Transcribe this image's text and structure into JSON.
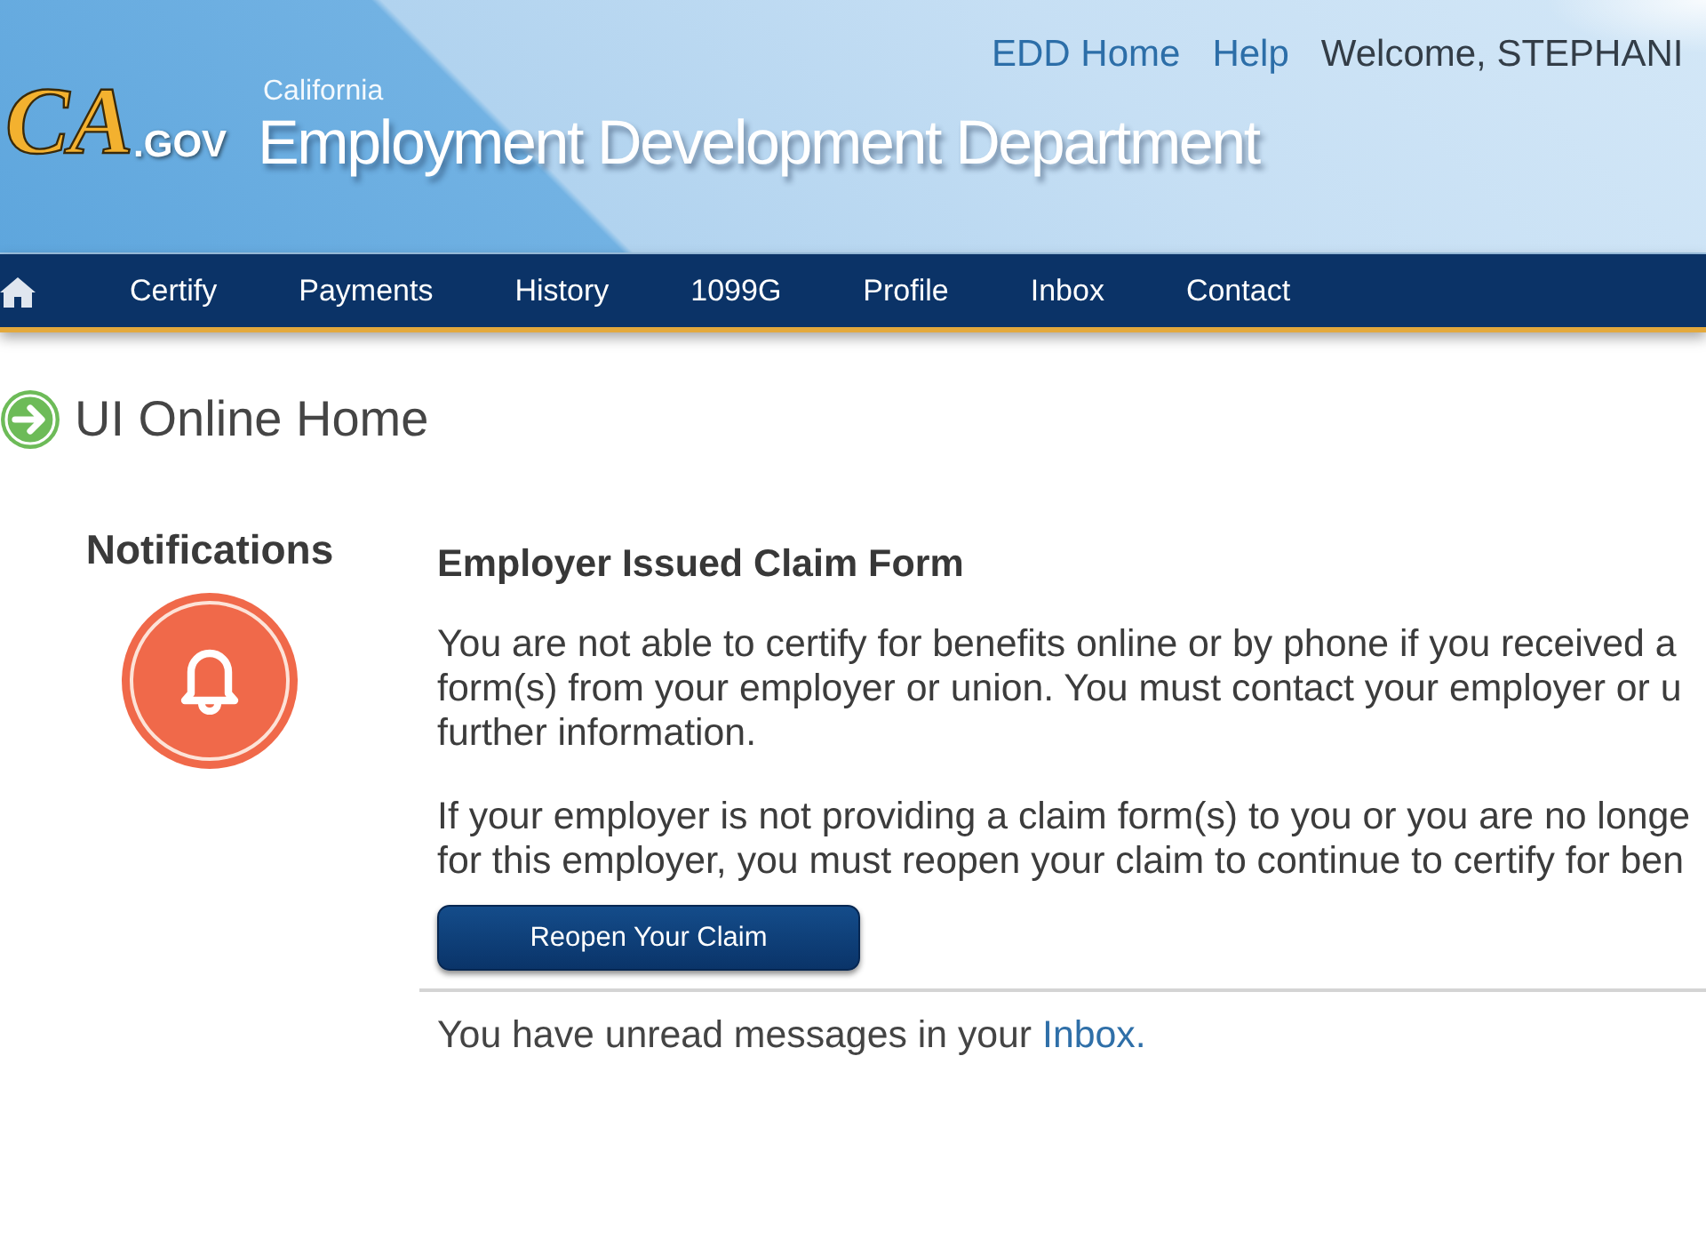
{
  "header": {
    "logo": {
      "mark": "CA",
      "suffix": ".GOV"
    },
    "state": "California",
    "department": "Employment Development Department",
    "links": [
      {
        "label": "EDD Home"
      },
      {
        "label": "Help"
      }
    ],
    "welcome": "Welcome, STEPHANI"
  },
  "nav": {
    "items": [
      {
        "label": "Certify"
      },
      {
        "label": "Payments"
      },
      {
        "label": "History"
      },
      {
        "label": "1099G"
      },
      {
        "label": "Profile"
      },
      {
        "label": "Inbox"
      },
      {
        "label": "Contact"
      }
    ]
  },
  "page_title": "UI Online Home",
  "notifications": {
    "heading": "Notifications"
  },
  "message": {
    "title": "Employer Issued Claim Form",
    "paragraphs": [
      {
        "lines": [
          "You are not able to certify for benefits online or by phone if you received a",
          "form(s) from your employer or union. You must contact your employer or u",
          "further information."
        ]
      },
      {
        "lines": [
          "If your employer is not providing a claim form(s) to you or you are no longe",
          "for this employer, you must reopen your claim to continue to certify for ben"
        ]
      }
    ],
    "button": "Reopen Your Claim"
  },
  "unread_notice": {
    "text": "You have unread messages in your",
    "link": "Inbox."
  }
}
